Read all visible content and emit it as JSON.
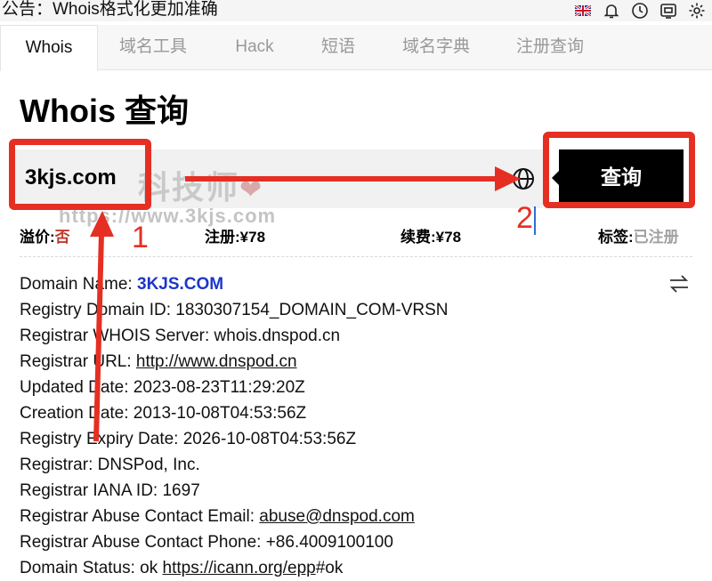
{
  "topbar": {
    "notice": "公告：Whois格式化更加准确",
    "icons": [
      "uk-flag-icon",
      "bell-icon",
      "clock-icon",
      "screenshot-icon",
      "gear-icon"
    ]
  },
  "tabs": [
    {
      "label": "Whois",
      "active": true
    },
    {
      "label": "域名工具"
    },
    {
      "label": "Hack"
    },
    {
      "label": "短语"
    },
    {
      "label": "域名字典"
    },
    {
      "label": "注册查询"
    }
  ],
  "page_title": "Whois 查询",
  "search": {
    "value": "3kjs.com",
    "button_label": "查询"
  },
  "watermark": {
    "line1": "科技师",
    "line2": "https://www.3kjs.com"
  },
  "annotations": {
    "marker1": "1",
    "marker2": "2"
  },
  "pricing": {
    "premium_label": "溢价:",
    "premium_value": "否",
    "register_label": "注册:",
    "register_value": "¥78",
    "renew_label": "续费:",
    "renew_value": "¥78",
    "tag_label": "标签:",
    "tag_value": "已注册"
  },
  "whois": {
    "domain_name_label": "Domain Name: ",
    "domain_name": "3KJS.COM",
    "registry_id": "Registry Domain ID: 1830307154_DOMAIN_COM-VRSN",
    "whois_server": "Registrar WHOIS Server: whois.dnspod.cn",
    "registrar_url_label": "Registrar URL: ",
    "registrar_url": "http://www.dnspod.cn",
    "updated": "Updated Date: 2023-08-23T11:29:20Z",
    "created": "Creation Date: 2013-10-08T04:53:56Z",
    "expiry": "Registry Expiry Date: 2026-10-08T04:53:56Z",
    "registrar": "Registrar: DNSPod, Inc.",
    "iana": "Registrar IANA ID: 1697",
    "abuse_email_label": "Registrar Abuse Contact Email: ",
    "abuse_email": "abuse@dnspod.com",
    "abuse_phone": "Registrar Abuse Contact Phone: +86.4009100100",
    "status_label": "Domain Status: ok ",
    "status_link": "https://icann.org/epp",
    "status_suffix": "#ok"
  },
  "colors": {
    "accent_red": "#e52f23",
    "link_blue": "#1d36c9"
  }
}
